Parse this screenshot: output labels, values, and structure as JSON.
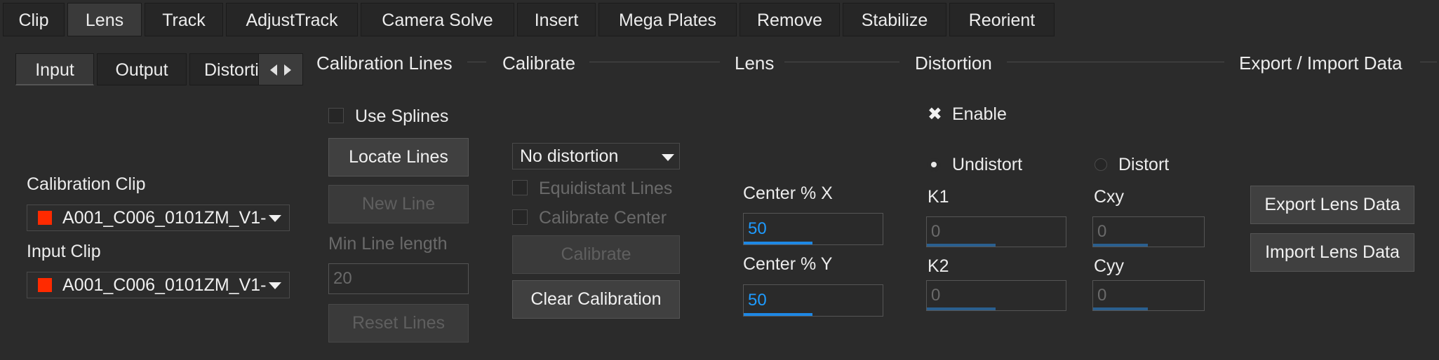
{
  "tabs": [
    "Clip",
    "Lens",
    "Track",
    "AdjustTrack",
    "Camera Solve",
    "Insert",
    "Mega Plates",
    "Remove",
    "Stabilize",
    "Reorient"
  ],
  "subtabs": [
    "Input",
    "Output",
    "Distortion"
  ],
  "left": {
    "calibration_clip_label": "Calibration Clip",
    "calibration_clip_value": "A001_C006_0101ZM_V1-",
    "input_clip_label": "Input Clip",
    "input_clip_value": "A001_C006_0101ZM_V1-",
    "clip_color": "#ff2a00"
  },
  "sections": {
    "calibration_lines": "Calibration Lines",
    "calibrate": "Calibrate",
    "lens": "Lens",
    "distortion": "Distortion",
    "export_import": "Export / Import Data"
  },
  "calibration_lines": {
    "use_splines": "Use Splines",
    "locate_lines": "Locate Lines",
    "new_line": "New Line",
    "min_line_length_label": "Min Line length",
    "min_line_length_value": "20",
    "reset_lines": "Reset Lines"
  },
  "calibrate": {
    "model": "No distortion",
    "equidistant_lines": "Equidistant Lines",
    "calibrate_center": "Calibrate Center",
    "calibrate_button": "Calibrate",
    "clear_calibration": "Clear Calibration"
  },
  "lens": {
    "center_x_label": "Center % X",
    "center_x_value": "50",
    "center_y_label": "Center % Y",
    "center_y_value": "50"
  },
  "distortion": {
    "enable_label": "Enable",
    "enable_glyph": "✖",
    "undistort_label": "Undistort",
    "distort_label": "Distort",
    "k1_label": "K1",
    "k1_value": "0",
    "k2_label": "K2",
    "k2_value": "0",
    "cxy_label": "Cxy",
    "cxy_value": "0",
    "cyy_label": "Cyy",
    "cyy_value": "0"
  },
  "export": {
    "export_lens_data": "Export Lens Data",
    "import_lens_data": "Import Lens Data"
  },
  "colors": {
    "accent": "#1e88e5",
    "value_blue": "#1e9bff"
  }
}
